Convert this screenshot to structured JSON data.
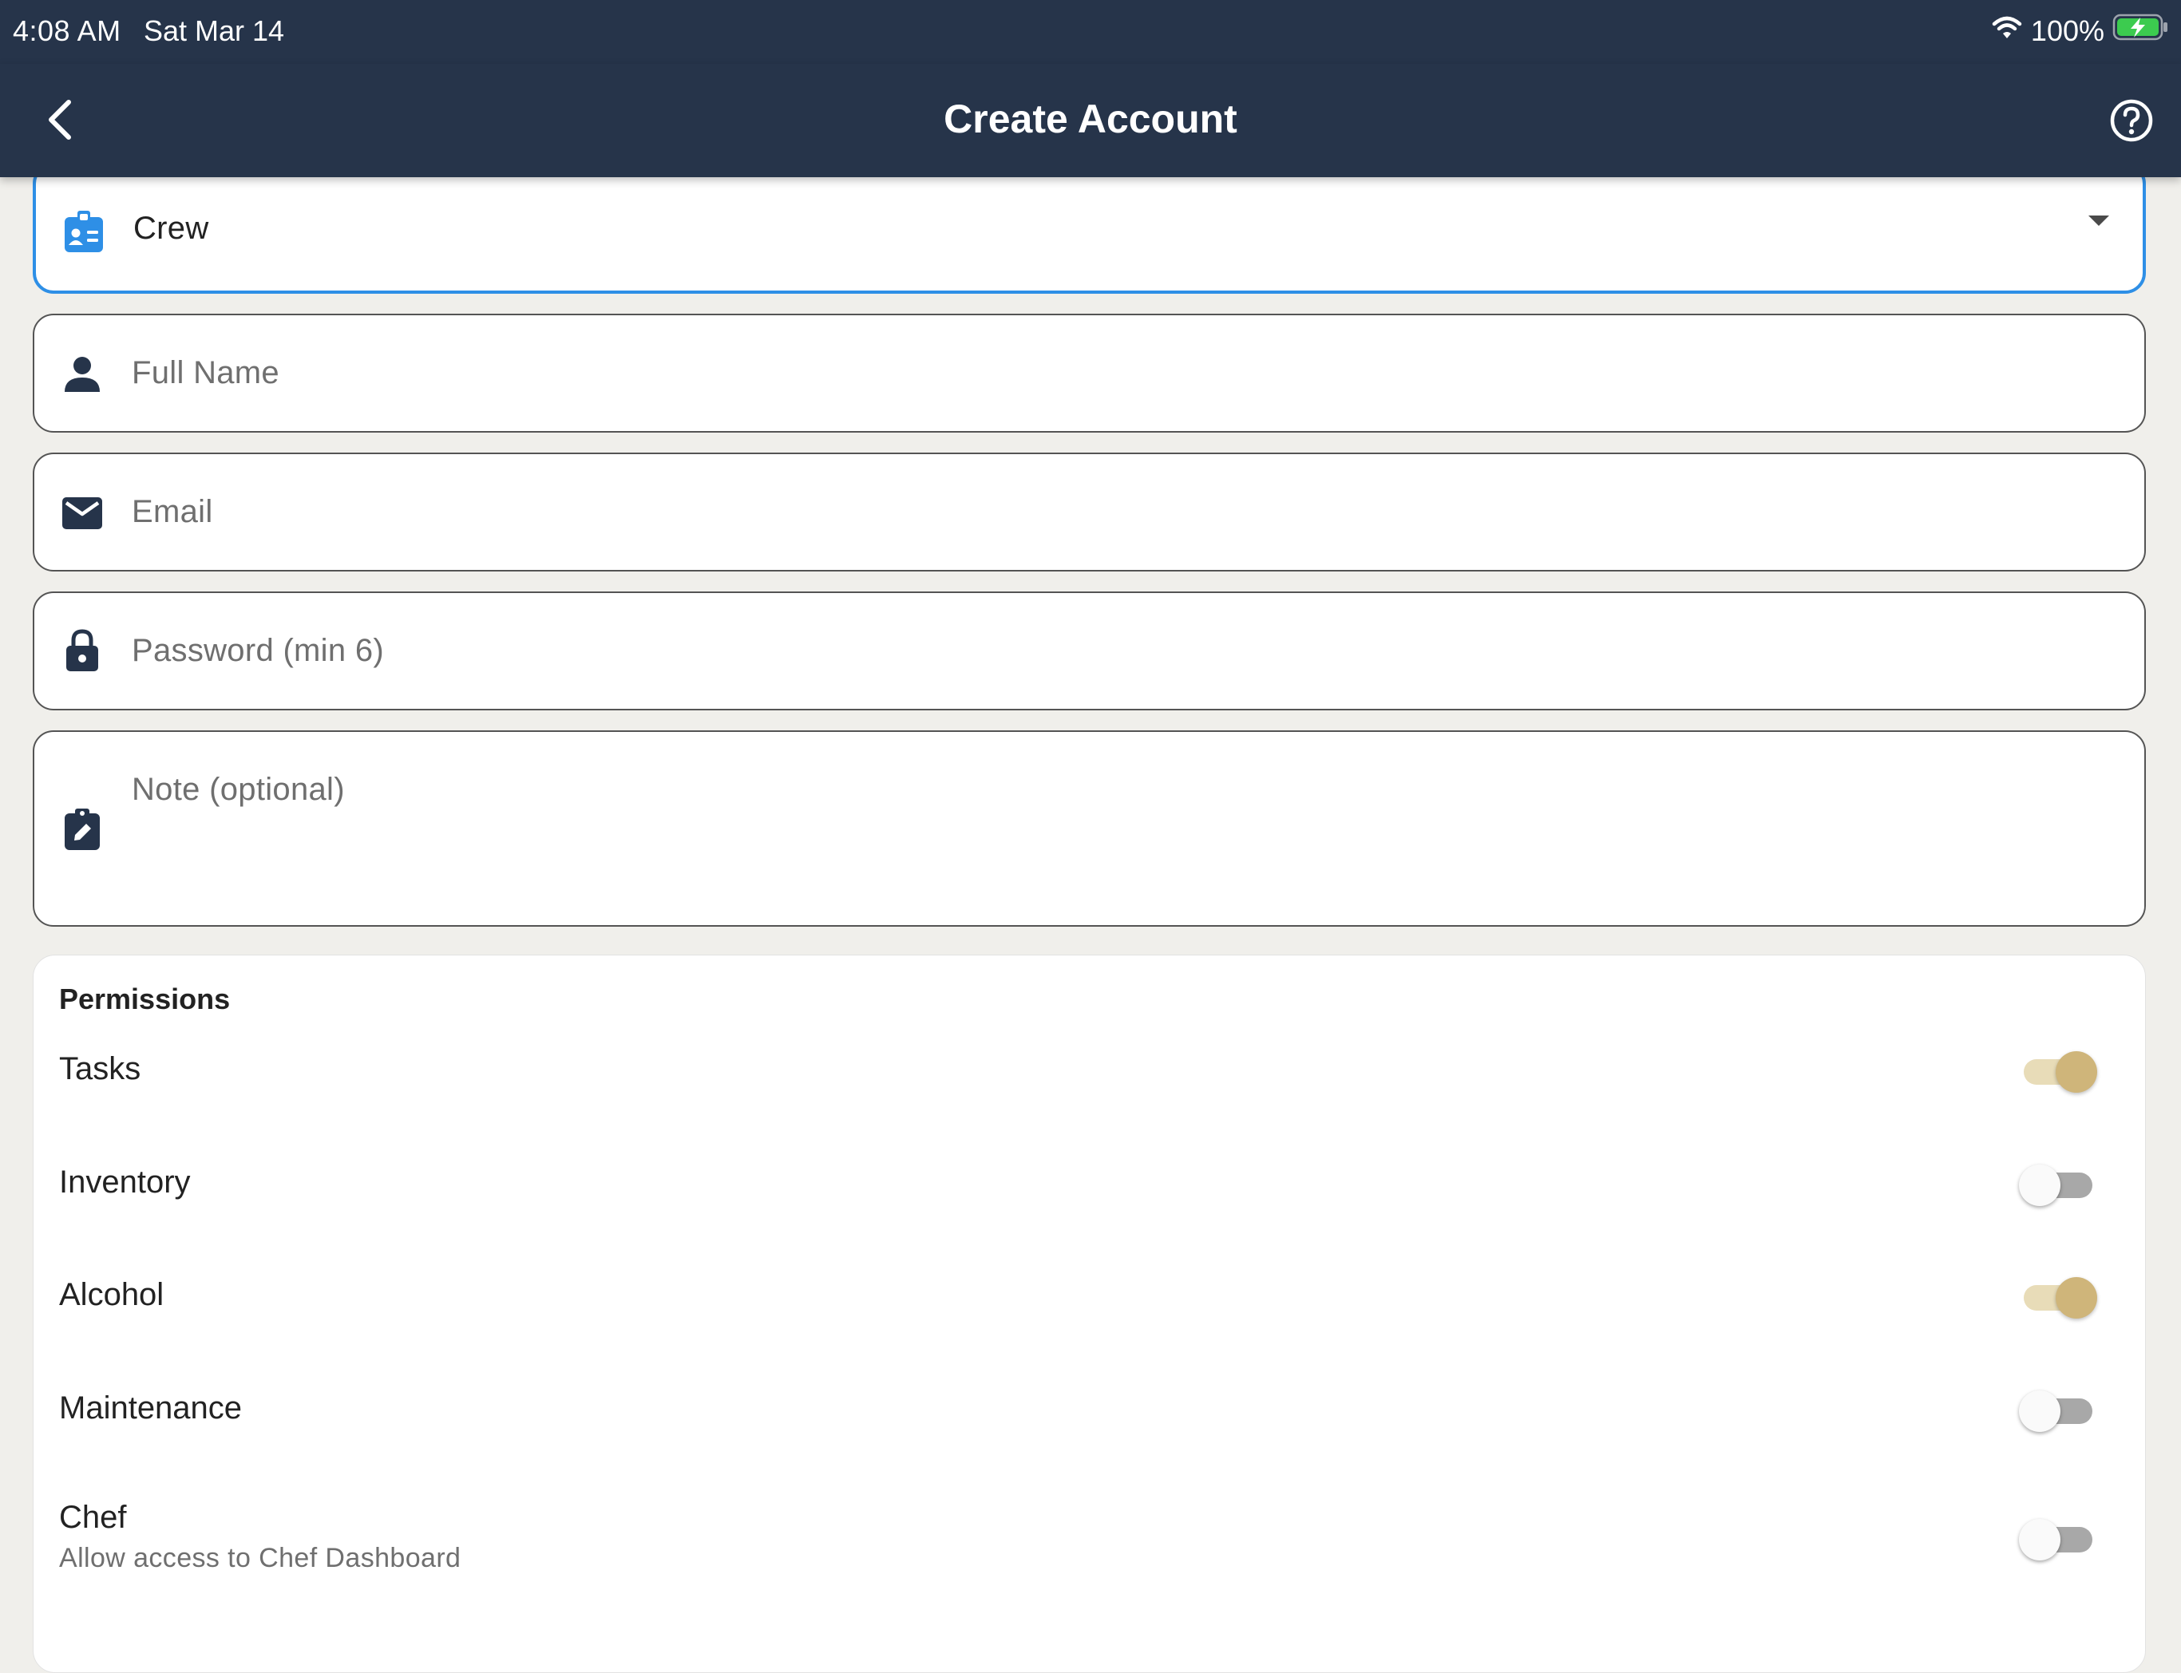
{
  "status_bar": {
    "time": "4:08 AM",
    "date": "Sat Mar 14",
    "battery": "100%",
    "icons": [
      "wifi-icon",
      "battery-charging-icon"
    ]
  },
  "nav": {
    "title": "Create Account",
    "back_icon": "chevron-left-icon",
    "help_icon": "help-circle-icon"
  },
  "form": {
    "role": {
      "value": "Crew",
      "icon": "badge-icon",
      "options_visible": [
        "Crew"
      ]
    },
    "full_name": {
      "placeholder": "Full Name",
      "value": "",
      "icon": "person-icon"
    },
    "email": {
      "placeholder": "Email",
      "value": "",
      "icon": "mail-icon"
    },
    "password": {
      "placeholder": "Password (min 6)",
      "value": "",
      "icon": "lock-icon"
    },
    "note": {
      "placeholder": "Note (optional)",
      "value": "",
      "icon": "clipboard-edit-icon"
    }
  },
  "permissions": {
    "title": "Permissions",
    "items": [
      {
        "label": "Tasks",
        "enabled": true
      },
      {
        "label": "Inventory",
        "enabled": false
      },
      {
        "label": "Alcohol",
        "enabled": true
      },
      {
        "label": "Maintenance",
        "enabled": false
      },
      {
        "label": "Chef",
        "subtitle": "Allow access to Chef Dashboard",
        "enabled": false
      }
    ]
  },
  "colors": {
    "header_bg": "#26344a",
    "page_bg": "#f0efeb",
    "active_border": "#2e8fe6",
    "toggle_on_knob": "#cfb57a",
    "toggle_on_track": "#e8dcb8",
    "toggle_off_track": "#a8a8a8",
    "battery_green": "#3ccb4f"
  }
}
